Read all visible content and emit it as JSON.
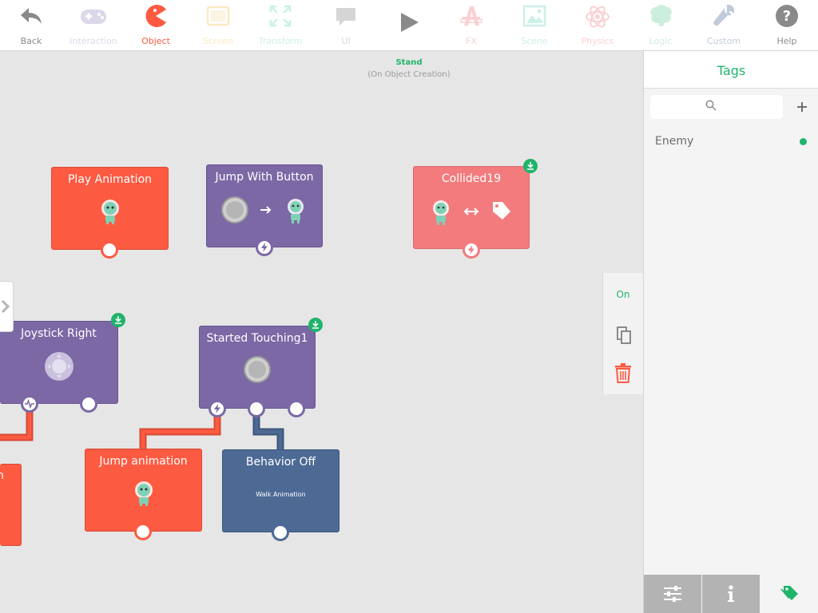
{
  "toolbar": {
    "items": [
      {
        "label": "Back",
        "icon": "back-arrow-icon",
        "color": "#8a8a8a"
      },
      {
        "label": "Interaction",
        "icon": "gamepad-icon",
        "color": "#9c8fc1"
      },
      {
        "label": "Object",
        "icon": "pacman-icon",
        "color": "#fd5a42"
      },
      {
        "label": "Screen",
        "icon": "screen-icon",
        "color": "#f5c257"
      },
      {
        "label": "Transform",
        "icon": "transform-icon",
        "color": "#6fd4c2"
      },
      {
        "label": "UI",
        "icon": "speech-bubble-icon",
        "color": "#8a8a8a"
      },
      {
        "label": "",
        "icon": "play-icon",
        "color": "#8a8a8a"
      },
      {
        "label": "FX",
        "icon": "fx-icon",
        "color": "#f37b7d"
      },
      {
        "label": "Scene",
        "icon": "picture-icon",
        "color": "#6fd4c2"
      },
      {
        "label": "Physics",
        "icon": "atom-icon",
        "color": "#f37b7d"
      },
      {
        "label": "Logic",
        "icon": "brain-icon",
        "color": "#6fd4a0"
      },
      {
        "label": "Custom",
        "icon": "wrench-icon",
        "color": "#4d6a95"
      },
      {
        "label": "Help",
        "icon": "help-icon",
        "color": "#8a8a8a"
      }
    ]
  },
  "canvas": {
    "object_title": "Stand",
    "object_subtitle": "(On Object Creation)",
    "blocks": {
      "play_animation": "Play Animation",
      "jump_with_button": "Jump With Button",
      "collided": "Collided19",
      "joystick_right": "Joystick Right",
      "started_touching": "Started Touching1",
      "jump_animation": "Jump animation",
      "behavior_off": "Behavior Off",
      "behavior_off_sub": "Walk Animation",
      "partial_left": "n"
    }
  },
  "side_controls": {
    "on_label": "On"
  },
  "right_panel": {
    "title": "Tags",
    "search_placeholder": "",
    "tags": [
      {
        "name": "Enemy",
        "color": "#1fb46a"
      }
    ]
  },
  "colors": {
    "accent": "#1fb46a",
    "object_red": "#fd5a42",
    "interaction_purple": "#7b68a5",
    "collision_pink": "#f37b7d",
    "behavior_navy": "#4d6a95"
  }
}
